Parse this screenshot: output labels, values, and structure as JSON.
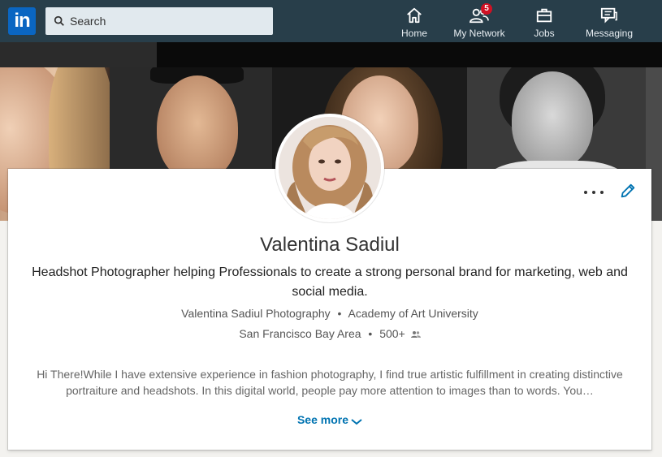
{
  "nav": {
    "logo_text": "in",
    "search_placeholder": "Search",
    "items": [
      {
        "label": "Home",
        "icon": "home-icon"
      },
      {
        "label": "My Network",
        "icon": "network-icon",
        "badge": "5"
      },
      {
        "label": "Jobs",
        "icon": "briefcase-icon"
      },
      {
        "label": "Messaging",
        "icon": "chat-icon"
      }
    ]
  },
  "profile": {
    "name": "Valentina Sadiul",
    "headline": "Headshot Photographer helping Professionals to create a strong personal brand for marketing, web and social media.",
    "company": "Valentina Sadiul Photography",
    "school": "Academy of Art University",
    "location": "San Francisco Bay Area",
    "connections": "500+",
    "summary": "Hi There!While I have extensive experience in fashion photography, I find true artistic fulfillment in creating distinctive portraiture and headshots. In this digital world, people pay more attention to images than to words. You…",
    "see_more_label": "See more"
  },
  "colors": {
    "nav_bg": "#283e4a",
    "brand_blue": "#0a66c2",
    "link_blue": "#0073b1",
    "badge_red": "#d11124"
  }
}
